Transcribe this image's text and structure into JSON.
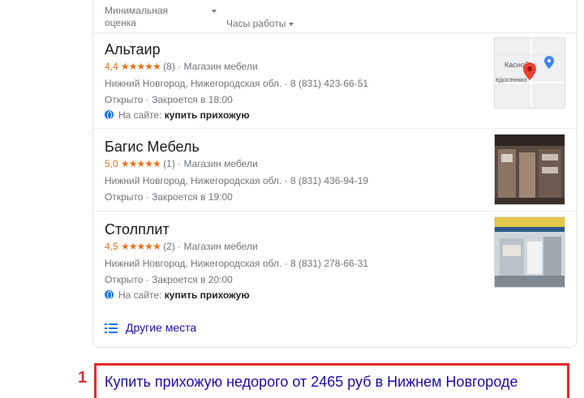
{
  "filters": {
    "rating": "Минимальная оценка",
    "hours": "Часы работы"
  },
  "places": [
    {
      "name": "Альтаир",
      "rating": "4,4",
      "stars": "★★★★★",
      "reviews": "(8)",
      "category": "Магазин мебели",
      "address": "Нижний Новгород, Нижегородская обл.",
      "phone": "8 (831) 423-66-51",
      "status": "Открыто · Закроется в 18:00",
      "site_prefix": "На сайте:",
      "site_query": "купить прихожую",
      "thumb_label_1": "Касноб",
      "thumb_label_2": "едосеенко"
    },
    {
      "name": "Багис Мебель",
      "rating": "5,0",
      "stars": "★★★★★",
      "reviews": "(1)",
      "category": "Магазин мебели",
      "address": "Нижний Новгород, Нижегородская обл.",
      "phone": "8 (831) 436-94-19",
      "status": "Открыто · Закроется в 19:00"
    },
    {
      "name": "Столплит",
      "rating": "4,5",
      "stars": "★★★★★",
      "reviews": "(2)",
      "category": "Магазин мебели",
      "address": "Нижний Новгород, Нижегородская обл.",
      "phone": "8 (831) 278-66-31",
      "status": "Открыто · Закроется в 20:00",
      "site_prefix": "На сайте:",
      "site_query": "купить прихожую"
    }
  ],
  "more_places": "Другие места",
  "result": {
    "number": "1",
    "title": "Купить прихожую недорого от 2465 руб в Нижнем Новгороде"
  },
  "colors": {
    "link": "#1a0dab",
    "star": "#e7711b",
    "highlight": "#e8282b",
    "pin": "#ea4335"
  }
}
